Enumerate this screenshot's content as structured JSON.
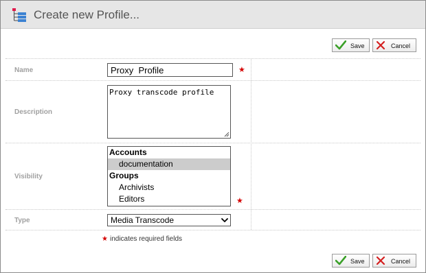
{
  "window": {
    "title": "Create new Profile...",
    "icon": "profile-tree-icon"
  },
  "toolbar": {
    "save_label": "Save",
    "cancel_label": "Cancel",
    "save_icon": "checkmark-icon",
    "cancel_icon": "x-icon"
  },
  "form": {
    "name": {
      "label": "Name",
      "value": "Proxy  Profile",
      "required": true
    },
    "description": {
      "label": "Description",
      "value": "Proxy transcode profile"
    },
    "visibility": {
      "label": "Visibility",
      "required": true,
      "options": [
        {
          "text": "Accounts",
          "kind": "group"
        },
        {
          "text": "documentation",
          "kind": "item",
          "selected": true
        },
        {
          "text": "Groups",
          "kind": "group"
        },
        {
          "text": "Archivists",
          "kind": "item"
        },
        {
          "text": "Editors",
          "kind": "item"
        }
      ]
    },
    "type": {
      "label": "Type",
      "value": "Media Transcode"
    }
  },
  "required_note": "indicates required fields",
  "colors": {
    "required_star": "#d40000",
    "save_check": "#3aa028",
    "cancel_x": "#d42020",
    "titlebar_bg": "#e6e6e6"
  }
}
